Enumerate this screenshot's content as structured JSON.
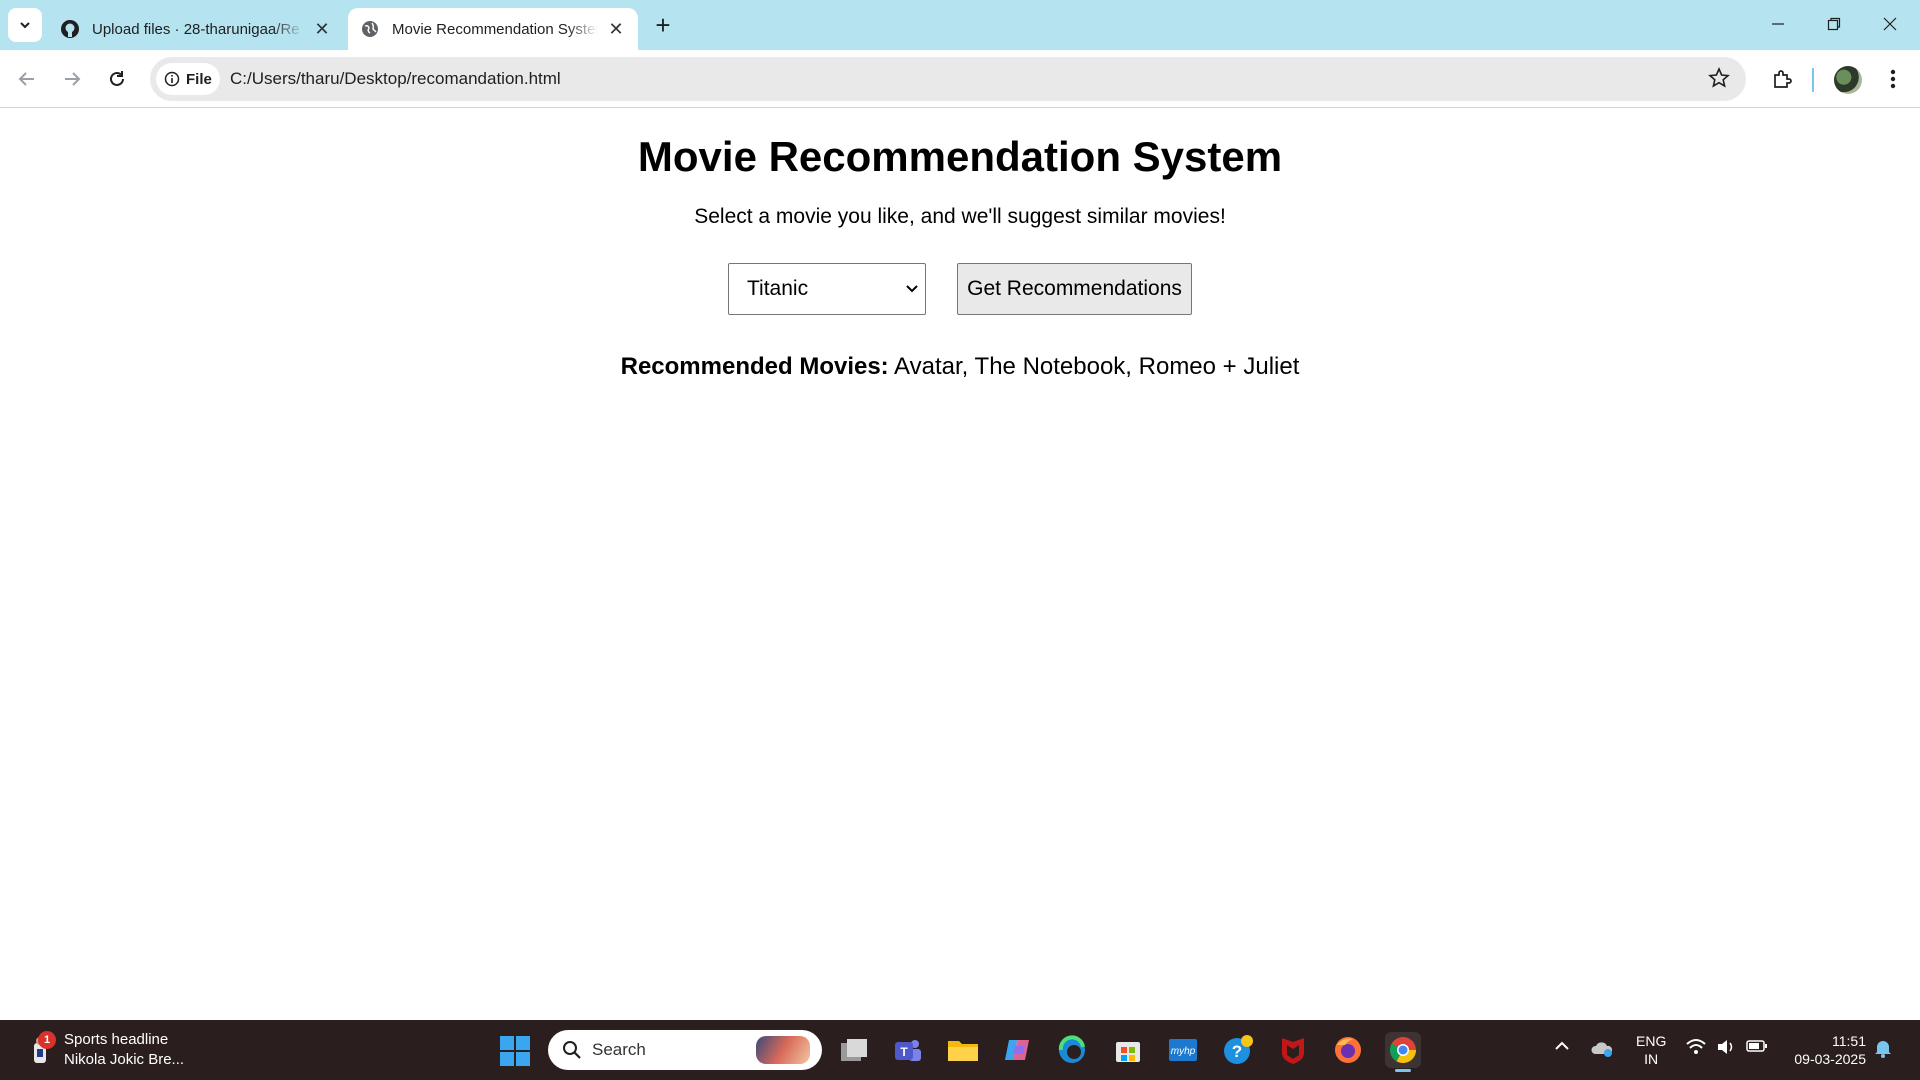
{
  "browser": {
    "tabs": [
      {
        "title": "Upload files · 28-tharunigaa/Re",
        "favicon": "github-icon",
        "active": false
      },
      {
        "title": "Movie Recommendation System",
        "favicon": "globe-icon",
        "active": true
      }
    ],
    "omnibox": {
      "chip_label": "File",
      "url": "C:/Users/tharu/Desktop/recomandation.html"
    }
  },
  "page": {
    "heading": "Movie Recommendation System",
    "subtitle": "Select a movie you like, and we'll suggest similar movies!",
    "movie_select": {
      "selected": "Titanic"
    },
    "button_label": "Get Recommendations",
    "result_label": "Recommended Movies:",
    "result_value": "Avatar, The Notebook, Romeo + Juliet"
  },
  "taskbar": {
    "widget": {
      "badge": "1",
      "title": "Sports headline",
      "subtitle": "Nikola Jokic Bre..."
    },
    "search_placeholder": "Search",
    "lang_line1": "ENG",
    "lang_line2": "IN",
    "time": "11:51",
    "date": "09-03-2025"
  },
  "colors": {
    "tabstrip": "#b5e3ef",
    "taskbar": "#2a1f1e",
    "start_blue": "#3ba6f0",
    "button_bg": "#e9e9e9"
  }
}
